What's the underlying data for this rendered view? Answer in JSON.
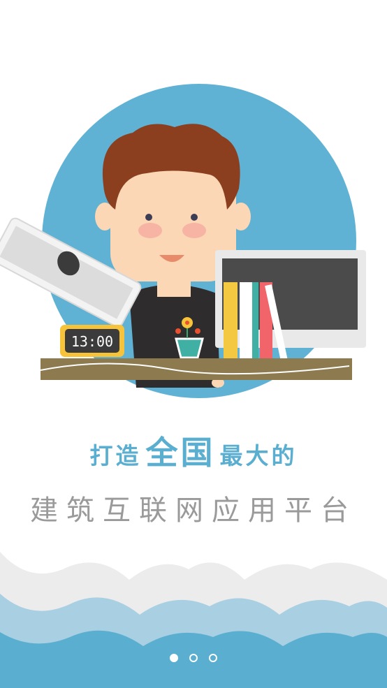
{
  "headline": {
    "prefix": "打造",
    "emphasis": "全国",
    "suffix": "最大的",
    "subtitle": "建筑互联网应用平台"
  },
  "clock": {
    "time": "13:00"
  },
  "pager": {
    "total": 3,
    "active_index": 0
  },
  "colors": {
    "accent": "#5aaed0",
    "circle": "#5fb2d4",
    "subtitle": "#9a9a9a",
    "hair": "#8b3f1f",
    "desk": "#8e7a4f"
  }
}
